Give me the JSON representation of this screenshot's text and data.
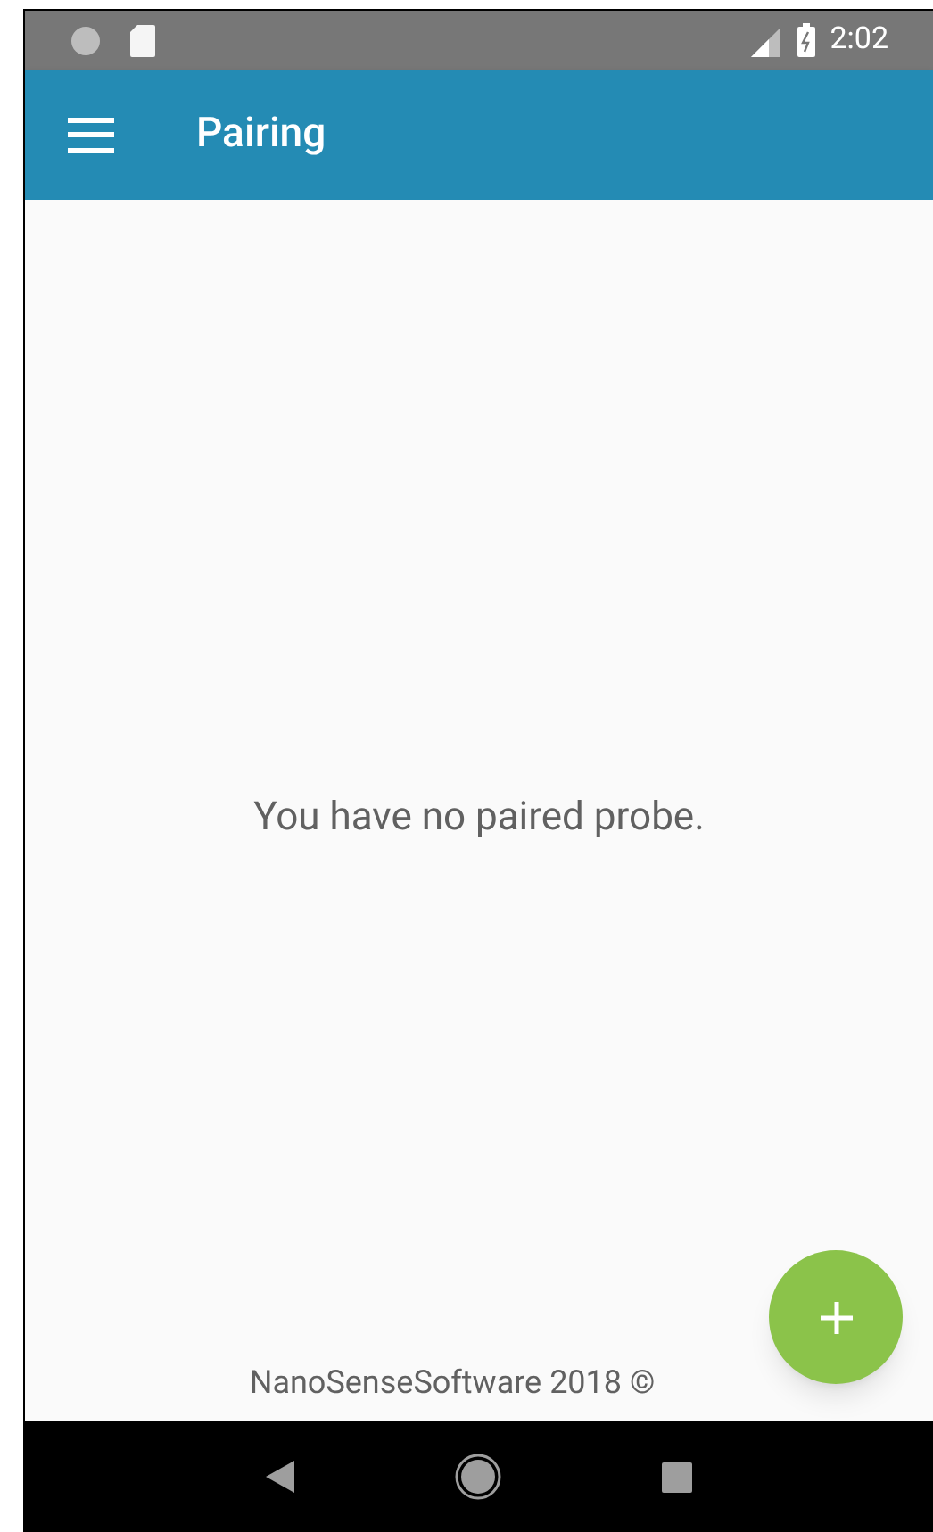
{
  "status_bar": {
    "time": "2:02"
  },
  "app_bar": {
    "title": "Pairing"
  },
  "empty_message": "You have no paired probe.",
  "footer": "NanoSenseSoftware 2018 ©"
}
